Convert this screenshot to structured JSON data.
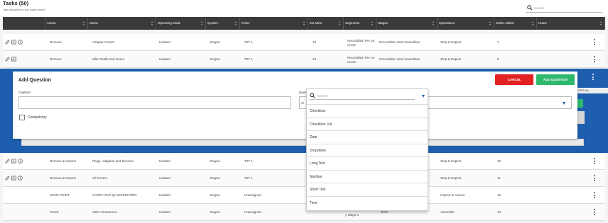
{
  "page": {
    "title": "Tasks (50)",
    "subtitle": "Task assigned in this asset model",
    "search_placeholder": "Search"
  },
  "table": {
    "headers": [
      "Action",
      "Name",
      "Operating Mode",
      "System",
      "Roles",
      "Est Mins",
      "Segments",
      "Stages",
      "Operations",
      "Order Added",
      "Notes"
    ],
    "rows": [
      {
        "action": "Remove",
        "name": "Adapter Covers",
        "mode": "Isolated",
        "system": "Engine",
        "roles": "T2T 1",
        "est": "10",
        "segments": "Recondition Pre on Cover",
        "stages": "Recondition Sub Assemblies",
        "operations": "Strip & Inspect",
        "order": "7"
      },
      {
        "action": "Remove",
        "name": "Idler Shafts and Gears",
        "mode": "Isolated",
        "system": "Engine",
        "roles": "T2T 1",
        "est": "15",
        "segments": "Recondition Pre on Cover",
        "stages": "Recondition Sub Assemblies",
        "operations": "Strip & Inspect",
        "order": "8"
      },
      {
        "action": "Remove & Inspect",
        "name": "Plugs, Adapters and Sensors",
        "mode": "Isolated",
        "system": "Engine",
        "roles": "T2T 1",
        "est": "",
        "segments": "",
        "stages": "",
        "operations": "Strip & Inspect",
        "order": "10"
      },
      {
        "action": "Remove & Inspect",
        "name": "Oil Covers",
        "mode": "Isolated",
        "system": "Engine",
        "roles": "T2T 1",
        "est": "",
        "segments": "",
        "stages": "",
        "operations": "Strip & Inspect",
        "order": "11"
      },
      {
        "action": "HOLD-POINT",
        "name": "CARRY OUT QA INSPECTION",
        "mode": "Isolated",
        "system": "Engine",
        "roles": "Unassigned",
        "est": "",
        "segments": "",
        "stages": "",
        "operations": "Inspect & Assess",
        "order": "12"
      },
      {
        "action": "Check",
        "name": "Valve Clearances",
        "mode": "Isolated",
        "system": "Engine",
        "roles": "Unassigned",
        "est": "",
        "segments": "y Stage 2",
        "stages": "Done",
        "operations": "Assemble",
        "order": "13"
      }
    ]
  },
  "behind_modal": {
    "header_fragment": "ENTS (0)"
  },
  "modal": {
    "title": "Add Question",
    "cancel_label": "CANCEL",
    "add_label": "ADD QUESTION",
    "caption_label": "Caption*",
    "caption_value": "",
    "question_type_label": "Ques",
    "question_type_value": "Si",
    "compulsory_label": "Compulsory"
  },
  "dropdown": {
    "search_placeholder": "Search",
    "options": [
      "Checkbox",
      "Checkbox List",
      "Date",
      "Dropdown",
      "Long Text",
      "Number",
      "Short Text",
      "Time"
    ]
  },
  "colors": {
    "header_bg": "#3a3a3a",
    "accent_blue": "#1d5fae",
    "cancel_red": "#e22222",
    "add_green": "#2db86c"
  }
}
